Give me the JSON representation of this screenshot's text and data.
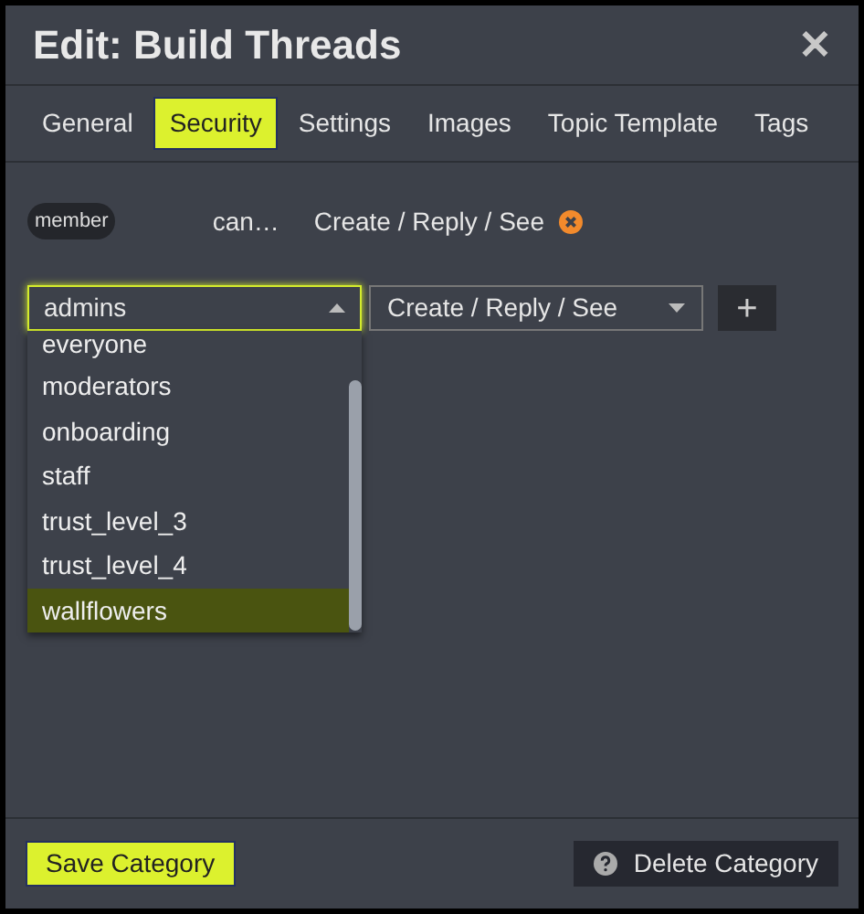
{
  "dialog": {
    "title": "Edit: Build Threads",
    "close": "✕"
  },
  "tabs": [
    {
      "label": "General",
      "selected": false
    },
    {
      "label": "Security",
      "selected": true
    },
    {
      "label": "Settings",
      "selected": false
    },
    {
      "label": "Images",
      "selected": false
    },
    {
      "label": "Topic Template",
      "selected": false
    },
    {
      "label": "Tags",
      "selected": false
    }
  ],
  "permissions": [
    {
      "group": "member",
      "can": "can…",
      "permission": "Create / Reply / See"
    }
  ],
  "group_select": {
    "value": "admins",
    "expanded": true,
    "options": [
      {
        "label": "everyone",
        "selected": false
      },
      {
        "label": "moderators",
        "selected": false
      },
      {
        "label": "onboarding",
        "selected": false
      },
      {
        "label": "staff",
        "selected": false
      },
      {
        "label": "trust_level_3",
        "selected": false
      },
      {
        "label": "trust_level_4",
        "selected": false
      },
      {
        "label": "wallflowers",
        "selected": true
      }
    ]
  },
  "permission_select": {
    "value": "Create / Reply / See"
  },
  "add_button": "+",
  "footer": {
    "save": "Save Category",
    "delete": "Delete Category"
  }
}
